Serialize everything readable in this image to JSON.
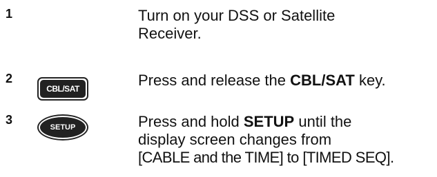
{
  "steps": [
    {
      "number": "1",
      "lines": [
        "Turn on your DSS or Satellite",
        "Receiver."
      ]
    },
    {
      "number": "2",
      "key_label": "CBL/SAT",
      "text_before": "Press and release the ",
      "text_bold": "CBL/SAT",
      "text_after": " key."
    },
    {
      "number": "3",
      "key_label": "SETUP",
      "text_before": "Press and hold ",
      "text_bold": "SETUP",
      "text_after": " until the",
      "line2": "display screen changes from",
      "line3": "[CABLE and the TIME] to [TIMED SEQ]."
    }
  ]
}
